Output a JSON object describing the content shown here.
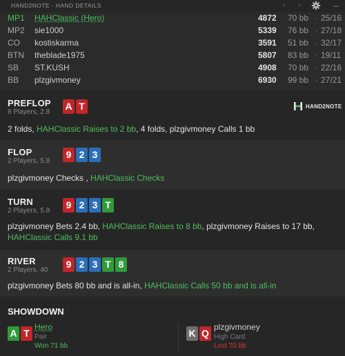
{
  "window": {
    "title": "HAND2NOTE - HAND DETAILS"
  },
  "players": [
    {
      "pos": "MP1",
      "name": "HAHClassic (Hero)",
      "stack": "4872",
      "bb": "70 bb",
      "stat": "25/16",
      "hero": true
    },
    {
      "pos": "MP2",
      "name": "sie1000",
      "stack": "5339",
      "bb": "76 bb",
      "stat": "27/18",
      "hero": false
    },
    {
      "pos": "CO",
      "name": "kostiskarma",
      "stack": "3591",
      "bb": "51 bb",
      "stat": "32/17",
      "hero": false
    },
    {
      "pos": "BTN",
      "name": "theblade1975",
      "stack": "5807",
      "bb": "83 bb",
      "stat": "19/11",
      "hero": false
    },
    {
      "pos": "SB",
      "name": "ST.KUSH",
      "stack": "4908",
      "bb": "70 bb",
      "stat": "22/16",
      "hero": false
    },
    {
      "pos": "BB",
      "name": "plzgivmoney",
      "stack": "6930",
      "bb": "99 bb",
      "stat": "27/21",
      "hero": false
    }
  ],
  "preflop": {
    "street": "PREFLOP",
    "info": "8 Players, 2.8",
    "cards": [
      {
        "rank": "A",
        "suit": "red"
      },
      {
        "rank": "T",
        "suit": "red"
      }
    ],
    "action": [
      {
        "t": "2 folds, ",
        "g": false
      },
      {
        "t": "HAHClassic Raises to 2 bb",
        "g": true
      },
      {
        "t": ", 4 folds, plzgivmoney Calls 1 bb",
        "g": false
      }
    ]
  },
  "flop": {
    "street": "FLOP",
    "info": "2 Players, 5.8",
    "cards": [
      {
        "rank": "9",
        "suit": "red"
      },
      {
        "rank": "2",
        "suit": "blue"
      },
      {
        "rank": "3",
        "suit": "blue"
      }
    ],
    "action": [
      {
        "t": "plzgivmoney Checks , ",
        "g": false
      },
      {
        "t": "HAHClassic Checks",
        "g": true
      }
    ]
  },
  "turn": {
    "street": "TURN",
    "info": "2 Players, 5.8",
    "cards": [
      {
        "rank": "9",
        "suit": "red"
      },
      {
        "rank": "2",
        "suit": "blue"
      },
      {
        "rank": "3",
        "suit": "blue"
      },
      {
        "rank": "T",
        "suit": "green"
      }
    ],
    "action": [
      {
        "t": "plzgivmoney Bets 2.4 bb, ",
        "g": false
      },
      {
        "t": "HAHClassic Raises to 8 bb",
        "g": true
      },
      {
        "t": ", plzgivmoney Raises to 17 bb, ",
        "g": false
      },
      {
        "t": "HAHClassic Calls 9.1 bb",
        "g": true
      }
    ]
  },
  "river": {
    "street": "RIVER",
    "info": "2 Players, 40",
    "cards": [
      {
        "rank": "9",
        "suit": "red"
      },
      {
        "rank": "2",
        "suit": "blue"
      },
      {
        "rank": "3",
        "suit": "blue"
      },
      {
        "rank": "T",
        "suit": "green"
      },
      {
        "rank": "8",
        "suit": "green"
      }
    ],
    "action": [
      {
        "t": "plzgivmoney Bets 80 bb and is all-in, ",
        "g": false
      },
      {
        "t": "HAHClassic Calls 50 bb and is all-in",
        "g": true
      }
    ]
  },
  "logo": {
    "text": "HAND2NOTE"
  },
  "showdown": {
    "title": "SHOWDOWN",
    "hero": {
      "name": "Hero",
      "hand": "Pair",
      "result": "Won 71 bb",
      "cards": [
        {
          "rank": "A",
          "suit": "green"
        },
        {
          "rank": "T",
          "suit": "red"
        }
      ]
    },
    "villain": {
      "name": "plzgivmoney",
      "hand": "High Card",
      "result": "Lost 70 bb",
      "cards": [
        {
          "rank": "K",
          "suit": "gray"
        },
        {
          "rank": "Q",
          "suit": "red"
        }
      ]
    }
  },
  "colors": {
    "green": "#4fbf5c",
    "red": "#c0262a",
    "blue": "#2a6fb8",
    "gray": "#6e6e6e",
    "lost": "#e0322f"
  },
  "icons": {
    "back": "chevron-left-icon",
    "forward": "chevron-right-icon",
    "settings": "gear-icon",
    "minimize": "minimize-icon"
  }
}
